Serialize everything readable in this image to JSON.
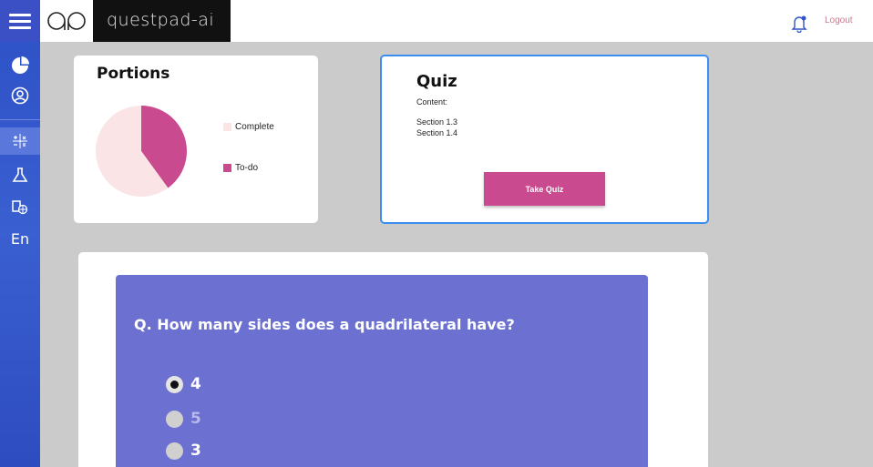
{
  "header": {
    "logo_text": "qp",
    "brand": "questpad-ai",
    "logout_label": "Logout",
    "icons": [
      "menu-icon",
      "bell-icon"
    ]
  },
  "sidebar": {
    "items": [
      {
        "icon": "pie-chart-icon"
      },
      {
        "icon": "user-circle-icon"
      },
      {
        "icon": "calculator-icon",
        "active": true
      },
      {
        "icon": "flask-icon"
      },
      {
        "icon": "globe-book-icon"
      },
      {
        "label": "En"
      }
    ]
  },
  "portions": {
    "title": "Portions",
    "legend": [
      {
        "label": "Complete",
        "color": "#fbe4e6"
      },
      {
        "label": "To-do",
        "color": "#c94a8e"
      }
    ]
  },
  "chart_data": {
    "type": "pie",
    "title": "Portions",
    "categories": [
      "Complete",
      "To-do"
    ],
    "values": [
      60,
      40
    ],
    "colors": [
      "#fbe4e6",
      "#c94a8e"
    ]
  },
  "quiz": {
    "title": "Quiz",
    "content_label": "Content:",
    "sections": [
      "Section 1.3",
      "Section 1.4"
    ],
    "button_label": "Take Quiz"
  },
  "question": {
    "text": "Q. How many sides does a quadrilateral have?",
    "options": [
      {
        "label": "4",
        "selected": true
      },
      {
        "label": "5",
        "selected": false
      },
      {
        "label": "3",
        "selected": false
      }
    ]
  },
  "colors": {
    "accent_blue": "#3a50c4",
    "quiz_border": "#3b8ef0",
    "button_pink": "#c94a8e",
    "question_panel": "#6b70d1"
  }
}
